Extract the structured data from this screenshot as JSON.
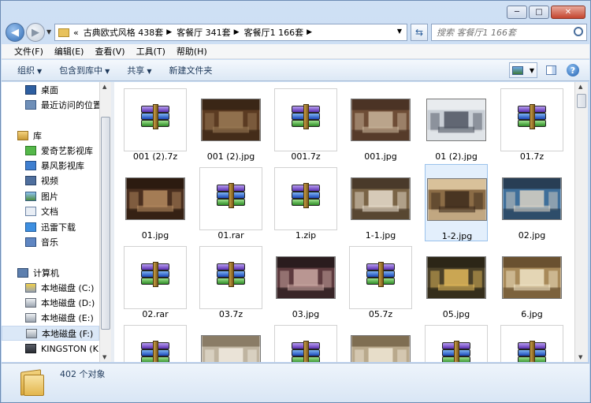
{
  "window": {
    "buttons": {
      "minimize": "─",
      "maximize": "□",
      "close": "✕"
    }
  },
  "nav": {
    "back_glyph": "◀",
    "forward_glyph": "▶",
    "breadcrumb_prefix": "«",
    "breadcrumbs": [
      "古典欧式风格 438套",
      "客餐厅 341套",
      "客餐厅1 166套"
    ],
    "search_placeholder": "搜索 客餐厅1 166套"
  },
  "menu": [
    "文件(F)",
    "编辑(E)",
    "查看(V)",
    "工具(T)",
    "帮助(H)"
  ],
  "toolbar": {
    "organize": "组织",
    "include": "包含到库中",
    "share": "共享",
    "new_folder": "新建文件夹",
    "help": "?"
  },
  "navpane": {
    "favorites": [
      {
        "label": "桌面",
        "icon": "desktop-icon"
      },
      {
        "label": "最近访问的位置",
        "icon": "recent-places-icon"
      }
    ],
    "library_header": "库",
    "libraries": [
      {
        "label": "爱奇艺影视库",
        "icon": "iqiyi-library-icon"
      },
      {
        "label": "暴风影视库",
        "icon": "baofeng-library-icon"
      },
      {
        "label": "视频",
        "icon": "video-library-icon"
      },
      {
        "label": "图片",
        "icon": "pictures-library-icon"
      },
      {
        "label": "文档",
        "icon": "documents-library-icon"
      },
      {
        "label": "迅雷下载",
        "icon": "xunlei-download-icon"
      },
      {
        "label": "音乐",
        "icon": "music-library-icon"
      }
    ],
    "computer_header": "计算机",
    "drives": [
      {
        "label": "本地磁盘 (C:)",
        "icon": "system-drive-icon"
      },
      {
        "label": "本地磁盘 (D:)",
        "icon": "hard-drive-icon"
      },
      {
        "label": "本地磁盘 (E:)",
        "icon": "hard-drive-icon"
      },
      {
        "label": "本地磁盘 (F:)",
        "icon": "hard-drive-icon",
        "selected": true
      },
      {
        "label": "KINGSTON (K:)",
        "icon": "usb-drive-icon"
      }
    ]
  },
  "files": [
    {
      "name": "001 (2).7z",
      "type": "archive"
    },
    {
      "name": "001 (2).jpg",
      "type": "image",
      "colors": [
        "#5b3b22",
        "#9a7a55",
        "#3a2616"
      ]
    },
    {
      "name": "001.7z",
      "type": "archive"
    },
    {
      "name": "001.jpg",
      "type": "image",
      "colors": [
        "#6e4d36",
        "#c8b49a",
        "#4b3325"
      ]
    },
    {
      "name": "01 (2).jpg",
      "type": "image",
      "colors": [
        "#c9cfd6",
        "#4f5561",
        "#e9ecef"
      ]
    },
    {
      "name": "01.7z",
      "type": "archive"
    },
    {
      "name": "01.jpg",
      "type": "image",
      "colors": [
        "#4a2f1f",
        "#b48a5f",
        "#2c1b10"
      ]
    },
    {
      "name": "01.rar",
      "type": "archive"
    },
    {
      "name": "1.zip",
      "type": "archive"
    },
    {
      "name": "1-1.jpg",
      "type": "image",
      "colors": [
        "#7a6446",
        "#e6dccc",
        "#4a3a2a"
      ]
    },
    {
      "name": "1-2.jpg",
      "type": "image",
      "colors": [
        "#8b6c46",
        "#3d2b1c",
        "#d9c19a"
      ],
      "selected": true
    },
    {
      "name": "02.jpg",
      "type": "image",
      "colors": [
        "#3f6f9a",
        "#d9d2c4",
        "#283e55"
      ]
    },
    {
      "name": "02.rar",
      "type": "archive"
    },
    {
      "name": "03.7z",
      "type": "archive"
    },
    {
      "name": "03.jpg",
      "type": "image",
      "colors": [
        "#5d3a3e",
        "#c9a7a1",
        "#2a1c1e"
      ]
    },
    {
      "name": "05.7z",
      "type": "archive"
    },
    {
      "name": "05.jpg",
      "type": "image",
      "colors": [
        "#4a4028",
        "#e0b85a",
        "#2c2617"
      ]
    },
    {
      "name": "6.jpg",
      "type": "image",
      "colors": [
        "#a88a5a",
        "#efe3c6",
        "#6a5130"
      ]
    },
    {
      "name": "",
      "type": "archive"
    },
    {
      "name": "",
      "type": "image",
      "colors": [
        "#bfb4a0",
        "#f1ebe0",
        "#8a7c66"
      ]
    },
    {
      "name": "",
      "type": "archive"
    },
    {
      "name": "",
      "type": "image",
      "colors": [
        "#b9a98c",
        "#efe6d4",
        "#7f6e52"
      ]
    },
    {
      "name": "",
      "type": "archive"
    },
    {
      "name": "",
      "type": "archive"
    }
  ],
  "status": {
    "count_text": "402 个对象"
  },
  "colors": {
    "selection": "#e3effc",
    "accent": "#1e395b"
  }
}
